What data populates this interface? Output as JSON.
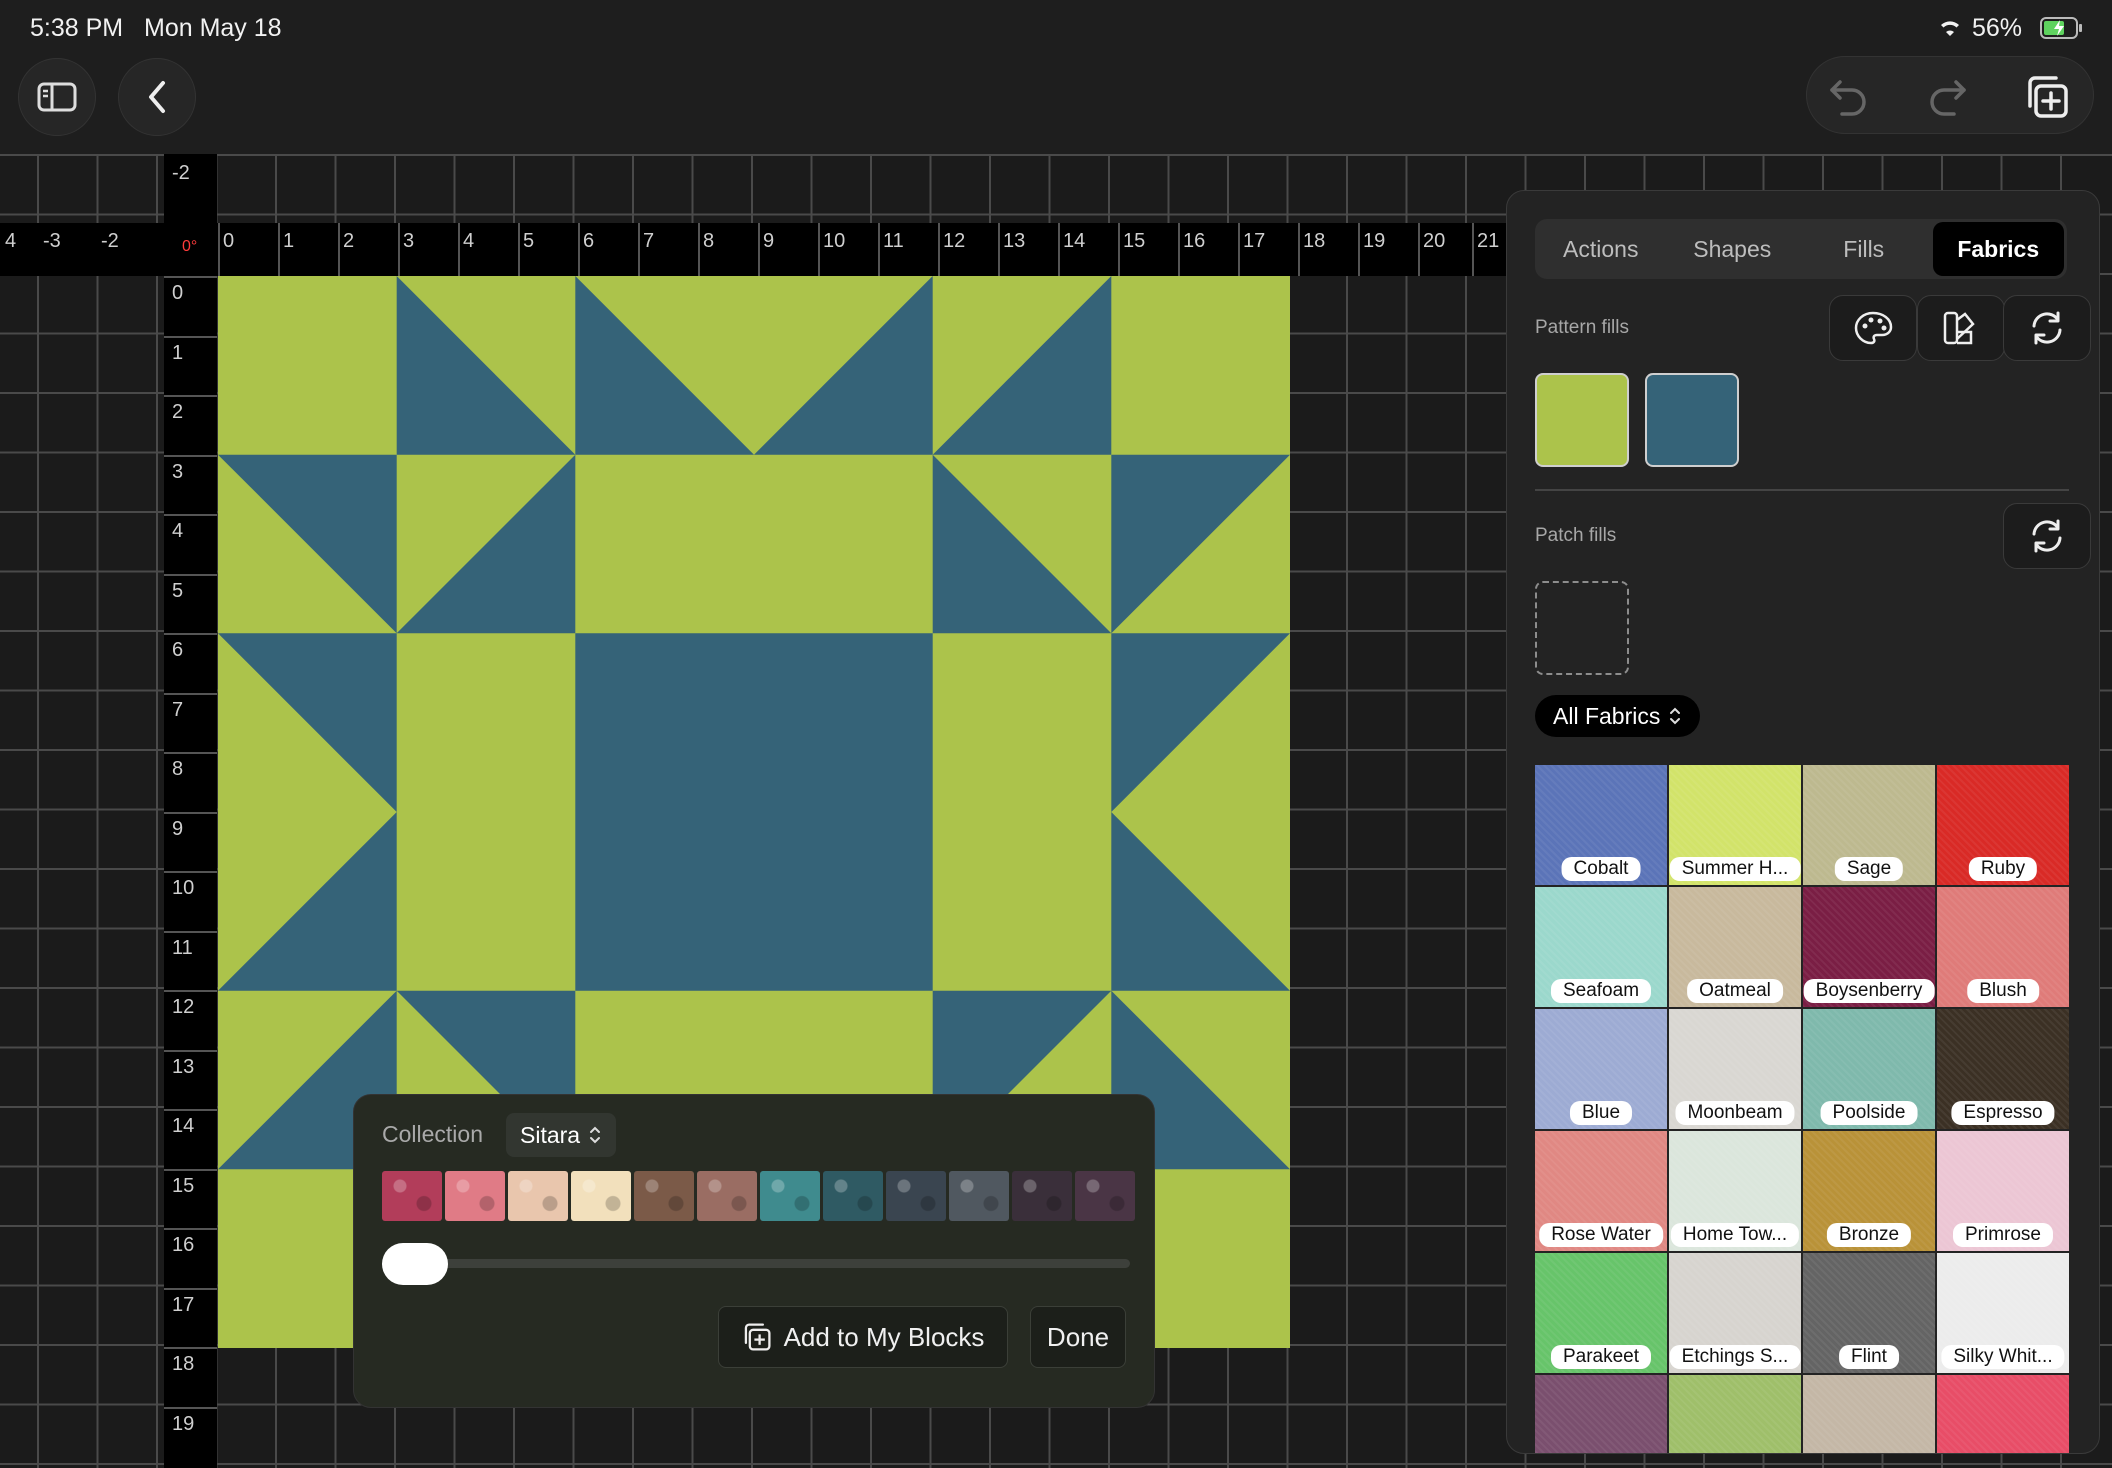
{
  "status_bar": {
    "time": "5:38 PM",
    "date": "Mon May 18",
    "battery": "56%"
  },
  "toolbar": {
    "sidebar_icon": "sidebar-icon",
    "back_icon": "chevron-left-icon",
    "undo_icon": "undo-icon",
    "redo_icon": "redo-icon",
    "add_icon": "add-copy-icon"
  },
  "ruler": {
    "origin_label": "0°",
    "top_ticks": [
      "-2"
    ],
    "h_labels": [
      "4",
      "-3",
      "-2",
      "0",
      "1",
      "2",
      "3",
      "4",
      "5",
      "6",
      "7",
      "8",
      "9",
      "10",
      "11",
      "12",
      "13",
      "14",
      "15",
      "16",
      "17",
      "18",
      "19",
      "20",
      "21"
    ],
    "v_labels": [
      "0",
      "1",
      "2",
      "3",
      "4",
      "5",
      "6",
      "7",
      "8",
      "9",
      "10",
      "11",
      "12",
      "13",
      "14",
      "15",
      "16",
      "17",
      "18",
      "19"
    ]
  },
  "colors": {
    "green": "#acc34b",
    "blue": "#356378"
  },
  "panel": {
    "tabs": [
      {
        "label": "Actions"
      },
      {
        "label": "Shapes"
      },
      {
        "label": "Fills"
      },
      {
        "label": "Fabrics"
      }
    ],
    "active_tab": "Fabrics",
    "pattern_fills_label": "Pattern fills",
    "patch_fills_label": "Patch fills",
    "all_fabrics": "All Fabrics",
    "fabrics": [
      {
        "name": "Cobalt",
        "color": "#5b74b8"
      },
      {
        "name": "Summer H...",
        "color": "#d2e36a"
      },
      {
        "name": "Sage",
        "color": "#bdb98f"
      },
      {
        "name": "Ruby",
        "color": "#d92a26"
      },
      {
        "name": "Seafoam",
        "color": "#9bd8cc"
      },
      {
        "name": "Oatmeal",
        "color": "#c8b99d"
      },
      {
        "name": "Boysenberry",
        "color": "#7a1e44"
      },
      {
        "name": "Blush",
        "color": "#df7b79"
      },
      {
        "name": "Blue",
        "color": "#9dabd3"
      },
      {
        "name": "Moonbeam",
        "color": "#d9d7d2"
      },
      {
        "name": "Poolside",
        "color": "#7fb9ac"
      },
      {
        "name": "Espresso",
        "color": "#3b3024"
      },
      {
        "name": "Rose Water",
        "color": "#e08883"
      },
      {
        "name": "Home Tow...",
        "color": "#dbe6dc"
      },
      {
        "name": "Bronze",
        "color": "#b99238"
      },
      {
        "name": "Primrose",
        "color": "#ecc6d4"
      },
      {
        "name": "Parakeet",
        "color": "#67c46a"
      },
      {
        "name": "Etchings S...",
        "color": "#d7d4cf"
      },
      {
        "name": "Flint",
        "color": "#646464"
      },
      {
        "name": "Silky Whit...",
        "color": "#ececec"
      },
      {
        "name": "",
        "color": "#7a4f6e"
      },
      {
        "name": "",
        "color": "#9fbf6a"
      },
      {
        "name": "",
        "color": "#c4b7a6"
      },
      {
        "name": "",
        "color": "#e84d67"
      }
    ]
  },
  "collection": {
    "label": "Collection",
    "name": "Sitara",
    "swatches": [
      "#b23d5a",
      "#e07b86",
      "#e9c6ad",
      "#f2e0bc",
      "#7b5a48",
      "#9a6d63",
      "#3f8b8e",
      "#2f5a63",
      "#3a4550",
      "#505860",
      "#3a2f3a",
      "#4a3545"
    ],
    "slider_value": 0,
    "add_button": "Add to My Blocks",
    "done_button": "Done"
  }
}
